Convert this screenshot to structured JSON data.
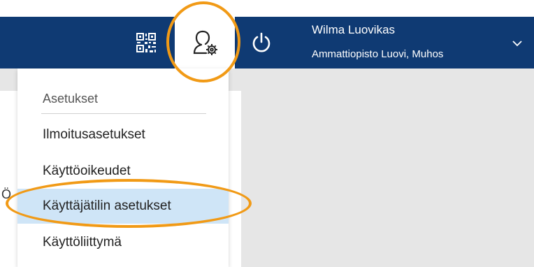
{
  "header": {
    "user_name": "Wilma Luovikas",
    "school": "Ammattiopisto Luovi, Muhos",
    "background_color": "#0f3a73",
    "icons": [
      "qr-code-icon",
      "user-settings-icon",
      "power-icon",
      "chevron-down-icon"
    ]
  },
  "dropdown": {
    "header": "Asetukset",
    "items": [
      {
        "label": "Ilmoitusasetukset"
      },
      {
        "label": "Käyttöoikeudet"
      },
      {
        "label": "Käyttäjätilin asetukset"
      },
      {
        "label": "Käyttöliittymä"
      }
    ],
    "active_index": 2,
    "active_color": "#cfe5f7"
  },
  "left_panel": {
    "partial_text": "Ö"
  },
  "annotation": {
    "highlight_color": "#f19a16"
  }
}
